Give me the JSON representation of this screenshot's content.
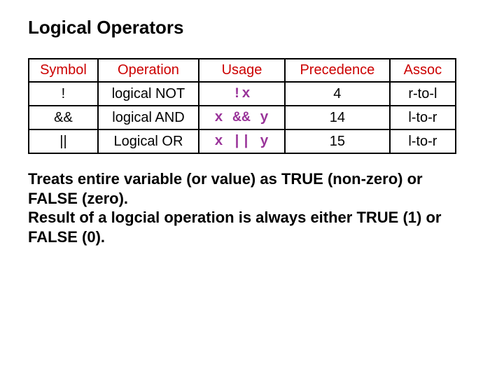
{
  "title": "Logical Operators",
  "table": {
    "headers": {
      "symbol": "Symbol",
      "operation": "Operation",
      "usage": "Usage",
      "precedence": "Precedence",
      "assoc": "Assoc"
    },
    "rows": [
      {
        "symbol": "!",
        "operation": "logical NOT",
        "usage": "!x",
        "precedence": "4",
        "assoc": "r-to-l"
      },
      {
        "symbol": "&&",
        "operation": "logical AND",
        "usage": "x && y",
        "precedence": "14",
        "assoc": "l-to-r"
      },
      {
        "symbol": "||",
        "operation": "Logical OR",
        "usage": "x || y",
        "precedence": "15",
        "assoc": "l-to-r"
      }
    ]
  },
  "body_text": {
    "line1": "Treats entire variable (or value) as TRUE (non-zero) or FALSE (zero).",
    "line2": "Result of a logcial operation is always either TRUE (1) or FALSE (0)."
  }
}
